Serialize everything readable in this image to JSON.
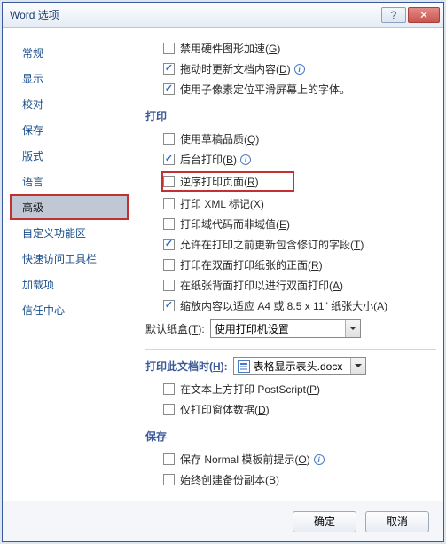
{
  "title": "Word 选项",
  "sidebar": {
    "items": [
      {
        "label": "常规"
      },
      {
        "label": "显示"
      },
      {
        "label": "校对"
      },
      {
        "label": "保存"
      },
      {
        "label": "版式"
      },
      {
        "label": "语言"
      },
      {
        "label": "高级"
      },
      {
        "label": "自定义功能区"
      },
      {
        "label": "快速访问工具栏"
      },
      {
        "label": "加载项"
      },
      {
        "label": "信任中心"
      }
    ]
  },
  "display_opts": {
    "hw_accel": {
      "label": "禁用硬件图形加速(",
      "key": "G",
      "tail": ")",
      "checked": false
    },
    "drag_update": {
      "label": "拖动时更新文档内容(",
      "key": "D",
      "tail": ")",
      "checked": true
    },
    "subpixel": {
      "label": "使用子像素定位平滑屏幕上的字体。",
      "checked": true
    }
  },
  "print_section": {
    "header": "打印",
    "draft": {
      "label": "使用草稿品质(",
      "key": "Q",
      "tail": ")",
      "checked": false
    },
    "background": {
      "label": "后台打印(",
      "key": "B",
      "tail": ")",
      "checked": true
    },
    "reverse": {
      "label": "逆序打印页面(",
      "key": "R",
      "tail": ")",
      "checked": false
    },
    "xml": {
      "label": "打印 XML 标记(",
      "key": "X",
      "tail": ")",
      "checked": false
    },
    "field_codes": {
      "label": "打印域代码而非域值(",
      "key": "E",
      "tail": ")",
      "checked": false
    },
    "update_tracked": {
      "label": "允许在打印之前更新包含修订的字段(",
      "key": "T",
      "tail": ")",
      "checked": true
    },
    "duplex_front": {
      "label": "打印在双面打印纸张的正面(",
      "key": "R",
      "tail": ")",
      "checked": false
    },
    "duplex_back": {
      "label": "在纸张背面打印以进行双面打印(",
      "key": "A",
      "tail": ")",
      "checked": false
    },
    "scale": {
      "label": "缩放内容以适应 A4 或 8.5 x 11\" 纸张大小(",
      "key": "A",
      "tail": ")",
      "checked": true
    },
    "default_tray": {
      "label": "默认纸盒(",
      "key": "T",
      "tail": "):",
      "value": "使用打印机设置"
    }
  },
  "print_doc_section": {
    "label": "打印此文档时(",
    "key": "H",
    "tail": "):",
    "value": "表格显示表头.docx",
    "postscript": {
      "label": "在文本上方打印 PostScript(",
      "key": "P",
      "tail": ")",
      "checked": false
    },
    "form_data": {
      "label": "仅打印窗体数据(",
      "key": "D",
      "tail": ")",
      "checked": false
    }
  },
  "save_section": {
    "header": "保存",
    "normal_prompt": {
      "label": "保存 Normal 模板前提示(",
      "key": "O",
      "tail": ")",
      "checked": false
    },
    "backup": {
      "label": "始终创建备份副本(",
      "key": "B",
      "tail": ")",
      "checked": false
    }
  },
  "footer": {
    "ok": "确定",
    "cancel": "取消"
  }
}
